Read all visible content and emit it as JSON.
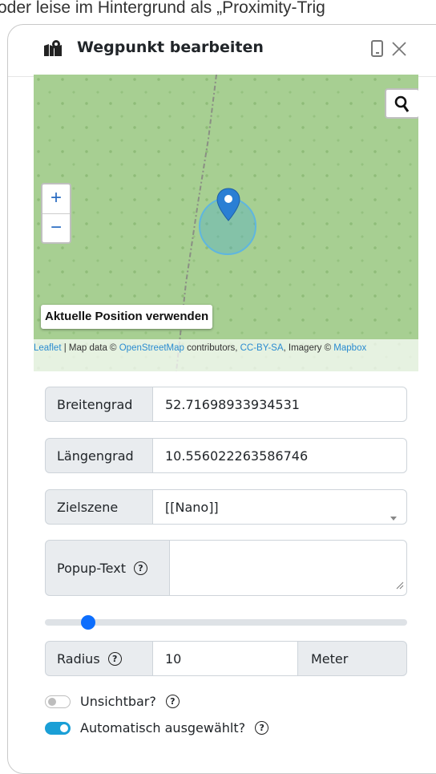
{
  "background_text": "oder leise im Hintergrund als „Proximity-Trig",
  "modal": {
    "title": "Wegpunkt bearbeiten",
    "icons": [
      "map-marker-icon",
      "phone-icon",
      "close-icon"
    ]
  },
  "map": {
    "zoom_in": "+",
    "zoom_out": "−",
    "use_position_button": "Aktuelle Position verwenden",
    "attribution": {
      "leaflet": "Leaflet",
      "sep1": " | Map data © ",
      "osm": "OpenStreetMap",
      "sep2": " contributors, ",
      "license": "CC-BY-SA",
      "sep3": ", Imagery © ",
      "mapbox": "Mapbox"
    },
    "colors": {
      "land": "#a7cf92",
      "radius_fill": "#46aad2",
      "marker": "#2a7fd4"
    }
  },
  "form": {
    "latitude": {
      "label": "Breitengrad",
      "value": "52.71698933934531"
    },
    "longitude": {
      "label": "Längengrad",
      "value": "10.556022263586746"
    },
    "target_scene": {
      "label": "Zielszene",
      "value": "[[Nano]]"
    },
    "popup_text": {
      "label": "Popup-Text",
      "help": "?",
      "value": ""
    },
    "radius": {
      "label": "Radius",
      "help": "?",
      "value": "10",
      "unit": "Meter",
      "slider_fraction": 0.12
    },
    "invisible": {
      "label": "Unsichtbar?",
      "help": "?",
      "checked": false
    },
    "auto_selected": {
      "label": "Automatisch ausgewählt?",
      "help": "?",
      "checked": true
    }
  },
  "accent": "#0d6efd"
}
